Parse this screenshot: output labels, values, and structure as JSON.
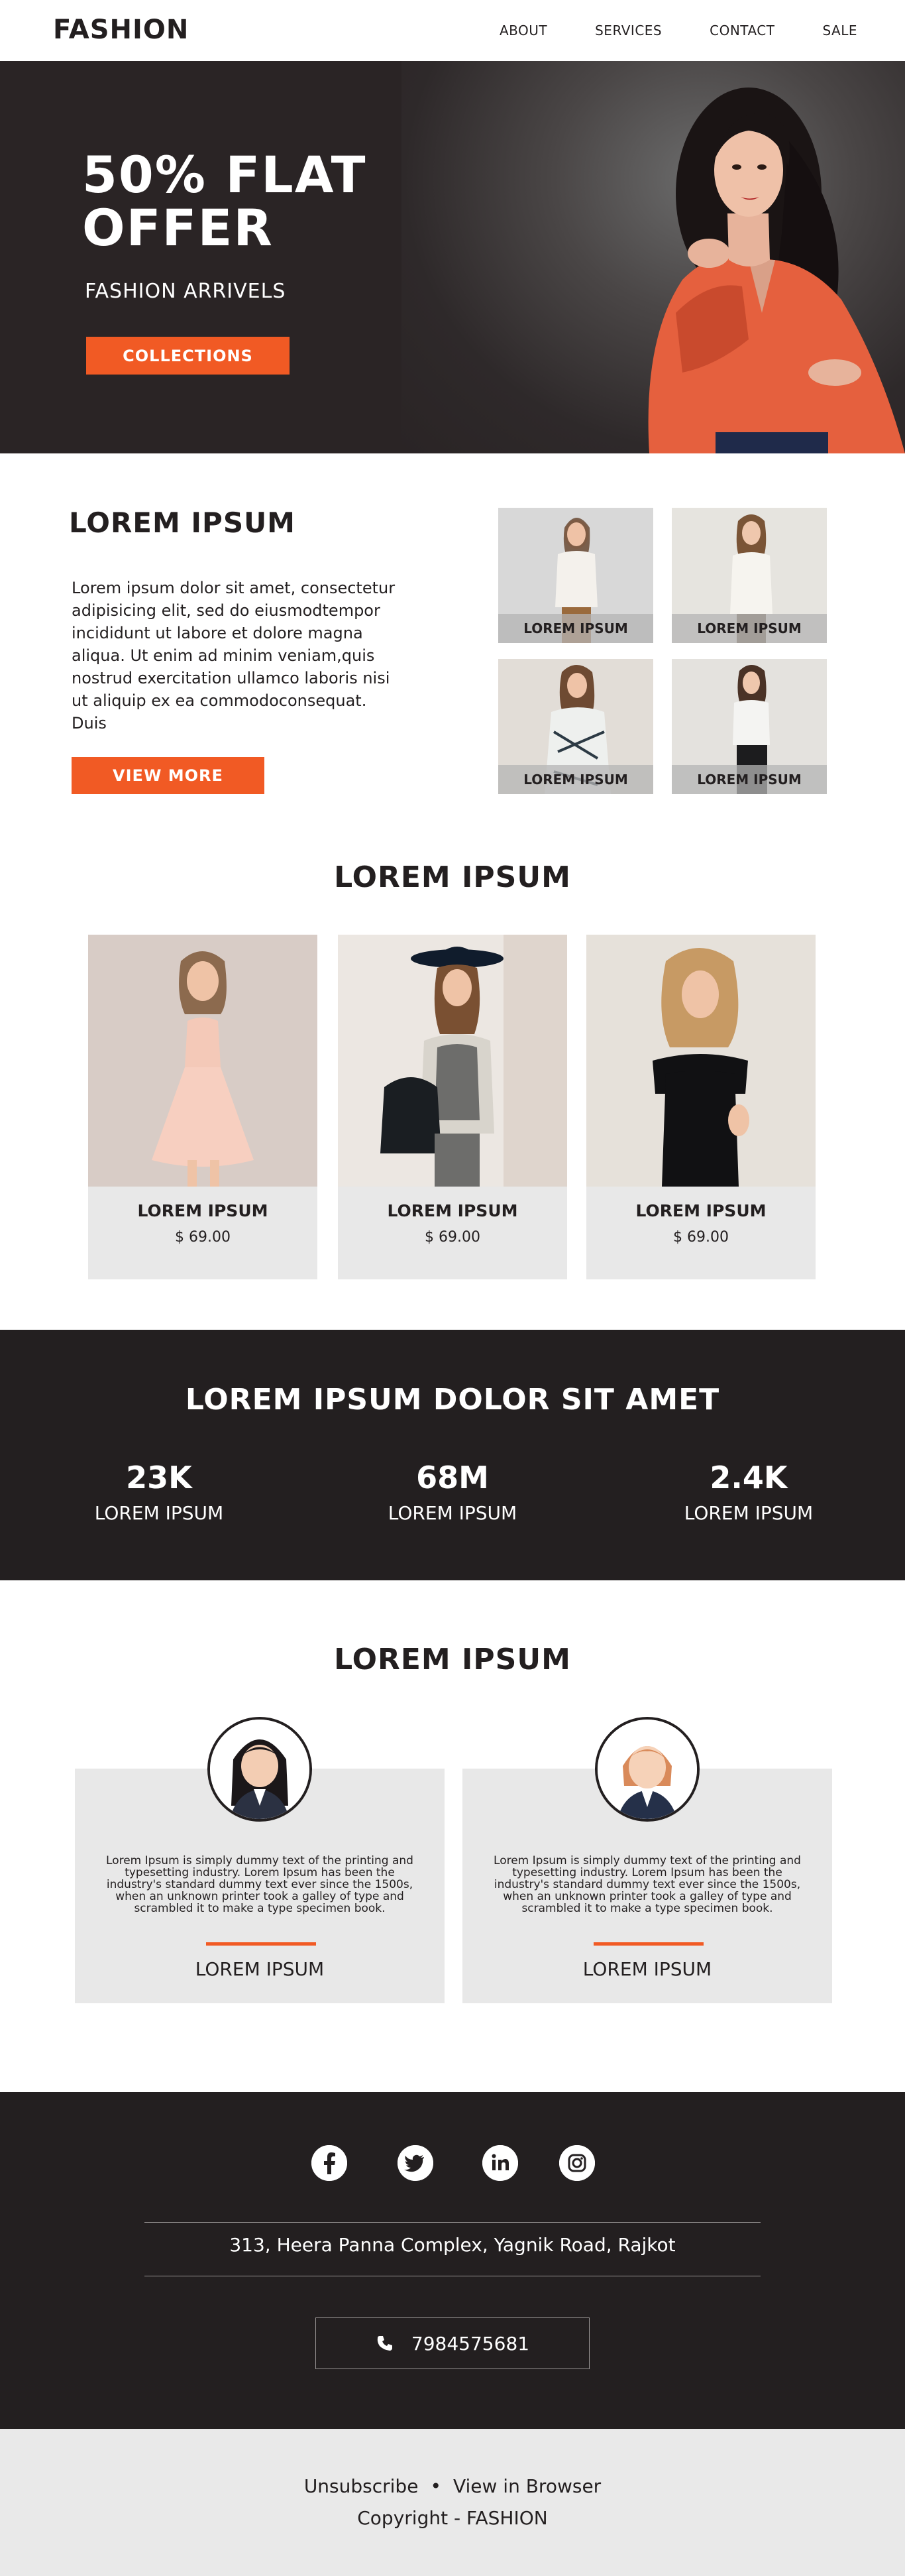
{
  "header": {
    "logo": "FASHION",
    "nav": [
      "ABOUT",
      "SERVICES",
      "CONTACT",
      "SALE"
    ]
  },
  "hero": {
    "title_line1": "50% FLAT",
    "title_line2": "OFFER",
    "subtitle": "FASHION ARRIVELS",
    "button": "COLLECTIONS"
  },
  "intro": {
    "title": "LOREM IPSUM",
    "text": "Lorem ipsum dolor sit amet, consectetur adipisicing elit, sed do eiusmodtempor incididunt ut labore et dolore magna aliqua. Ut enim ad minim veniam,quis nostrud exercitation ullamco laboris nisi ut aliquip ex ea commodoconsequat. Duis",
    "button": "VIEW MORE",
    "thumbs": [
      "LOREM IPSUM",
      "LOREM IPSUM",
      "LOREM IPSUM",
      "LOREM IPSUM"
    ]
  },
  "products": {
    "title": "LOREM IPSUM",
    "items": [
      {
        "name": "LOREM IPSUM",
        "price": "$ 69.00"
      },
      {
        "name": "LOREM IPSUM",
        "price": "$ 69.00"
      },
      {
        "name": "LOREM IPSUM",
        "price": "$ 69.00"
      }
    ]
  },
  "stats": {
    "title": "LOREM IPSUM DOLOR SIT AMET",
    "items": [
      {
        "value": "23K",
        "label": "LOREM IPSUM"
      },
      {
        "value": "68M",
        "label": "LOREM IPSUM"
      },
      {
        "value": "2.4K",
        "label": "LOREM IPSUM"
      }
    ]
  },
  "testimonials": {
    "title": "LOREM IPSUM",
    "items": [
      {
        "text": "Lorem Ipsum is simply dummy text of the printing and typesetting industry. Lorem Ipsum has been the industry's standard dummy text ever since the 1500s, when an unknown printer took a galley of type and scrambled it to make a type specimen book.",
        "name": "LOREM IPSUM"
      },
      {
        "text": "Lorem Ipsum is simply dummy text of the printing and typesetting industry. Lorem Ipsum has been the industry's standard dummy text ever since the 1500s, when an unknown printer took a galley of type and scrambled it to make a type specimen book.",
        "name": "LOREM IPSUM"
      }
    ]
  },
  "footer": {
    "social": [
      "facebook-icon",
      "twitter-icon",
      "linkedin-icon",
      "instagram-icon"
    ],
    "address": "313, Heera Panna Complex, Yagnik Road, Rajkot",
    "phone": "7984575681",
    "unsubscribe": "Unsubscribe",
    "view_in_browser": "View in Browser",
    "copyright": "Copyright - FASHION"
  },
  "colors": {
    "accent": "#f15a24",
    "dark": "#231f20",
    "light_gray": "#e8e8e8"
  }
}
